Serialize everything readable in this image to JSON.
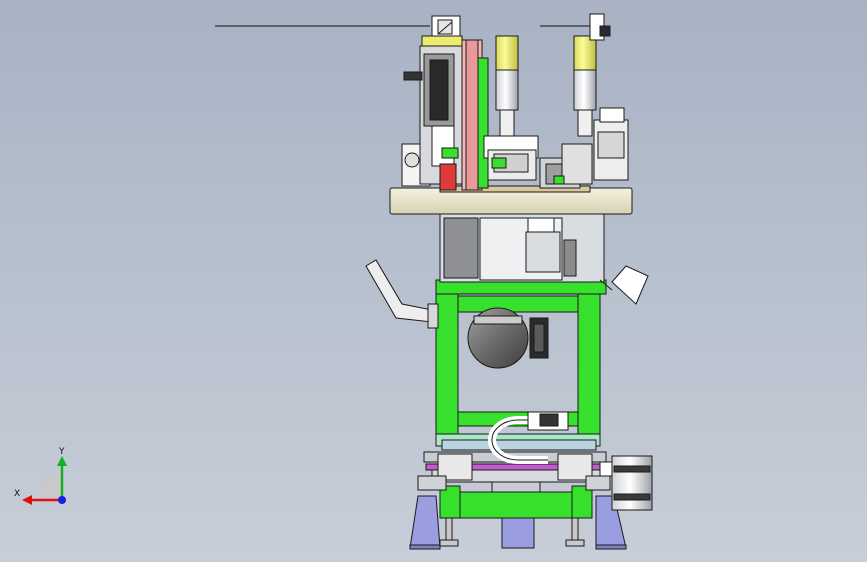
{
  "viewport": {
    "background_top": "#a9b2c3",
    "background_bottom": "#c7ced8"
  },
  "triad": {
    "x_label": "X",
    "y_label": "Y",
    "x_color": "#e01010",
    "y_color": "#10b020",
    "z_color": "#1020e0"
  },
  "colors": {
    "frame_green": "#36e02c",
    "base_purple": "#9a9ee0",
    "plate_cream": "#e6e2c8",
    "yellow_cylinder": "#ecec70",
    "outline": "#1a1a1a"
  }
}
